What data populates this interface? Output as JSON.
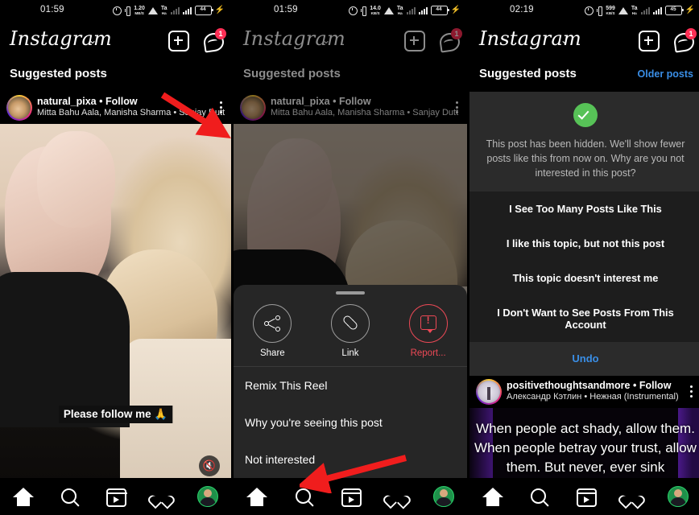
{
  "panels": [
    {
      "id": "panel-1-feed",
      "status": {
        "time": "01:59",
        "net_speed": "1.20",
        "net_unit": "MB/S",
        "battery": "44"
      },
      "header": {
        "logo": "Instagram",
        "chevron": "⌄",
        "create_icon": "plus-icon",
        "messenger_icon": "messenger-icon",
        "messenger_badge": "1"
      },
      "section": {
        "title": "Suggested posts"
      },
      "post": {
        "username": "natural_pixa",
        "separator": "•",
        "follow": "Follow",
        "subtitle": "Mitta Bahu Aala, Manisha Sharma • Sanjay Dutt",
        "caption": "Please follow me 🙏",
        "mute_icon": "muted-speaker-icon"
      },
      "nav": [
        "home-icon",
        "search-icon",
        "reels-icon",
        "heart-icon",
        "profile-avatar"
      ]
    },
    {
      "id": "panel-2-action-sheet",
      "status": {
        "time": "01:59",
        "net_speed": "14.0",
        "net_unit": "KB/S",
        "battery": "44"
      },
      "header": {
        "logo": "Instagram",
        "chevron": "⌄",
        "create_icon": "plus-icon",
        "messenger_icon": "messenger-icon",
        "messenger_badge": "1"
      },
      "section": {
        "title": "Suggested posts"
      },
      "post": {
        "username": "natural_pixa",
        "separator": "•",
        "follow": "Follow",
        "subtitle": "Mitta Bahu Aala, Manisha Sharma • Sanjay Dutt"
      },
      "sheet": {
        "actions": [
          {
            "label": "Share",
            "icon": "share-icon",
            "accent": "#ffffff"
          },
          {
            "label": "Link",
            "icon": "link-icon",
            "accent": "#ffffff"
          },
          {
            "label": "Report...",
            "icon": "report-icon",
            "accent": "#ed4956"
          }
        ],
        "items": [
          "Remix This Reel",
          "Why you're seeing this post",
          "Not interested"
        ]
      },
      "nav": [
        "home-icon",
        "search-icon",
        "reels-icon",
        "heart-icon",
        "profile-avatar"
      ]
    },
    {
      "id": "panel-3-hidden-feedback",
      "status": {
        "time": "02:19",
        "net_speed": "599",
        "net_unit": "KB/S",
        "battery": "45"
      },
      "header": {
        "logo": "Instagram",
        "chevron": "⌄",
        "create_icon": "plus-icon",
        "messenger_icon": "messenger-icon",
        "messenger_badge": "1"
      },
      "section": {
        "title": "Suggested posts",
        "older": "Older posts"
      },
      "hidden_card": {
        "check_icon": "success-check-icon",
        "message": "This post has been hidden. We'll show fewer posts like this from now on. Why are you not interested in this post?",
        "options": [
          "I See Too Many Posts Like This",
          "I like this topic, but not this post",
          "This topic doesn't interest me",
          "I Don't Want to See Posts From This Account"
        ],
        "undo": "Undo"
      },
      "post": {
        "username": "positivethoughtsandmore",
        "separator": "•",
        "follow": "Follow",
        "subtitle": "Александр Кэтлин • Нежная (Instrumental)",
        "quote": "When people act shady, allow them. When people betray your trust, allow them. But never, ever sink"
      },
      "nav": [
        "home-icon",
        "search-icon",
        "reels-icon",
        "heart-icon",
        "profile-avatar"
      ]
    }
  ],
  "annotations": {
    "arrow_color": "#f01d1d",
    "arrow_1_target": "post-kebab-menu",
    "arrow_2_target": "not-interested-item"
  },
  "colors": {
    "background": "#000000",
    "sheet": "#262626",
    "link_blue": "#3a8ee6",
    "report_red": "#ed4956",
    "success_green": "#57c257",
    "badge_red": "#ff2f55"
  }
}
